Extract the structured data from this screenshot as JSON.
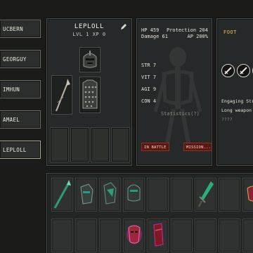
{
  "roster": [
    {
      "name": "UCBERN"
    },
    {
      "name": "GEORGUY"
    },
    {
      "name": "IMHUN"
    },
    {
      "name": "AMAEL"
    },
    {
      "name": "LEPLOLL"
    }
  ],
  "character": {
    "name": "LEPLOLL",
    "subtitle": "LVL 1   XP 0"
  },
  "stats": {
    "hp": "HP 459",
    "protection": "Protection 204",
    "damage": "Damage 61",
    "ap": "AP 200%",
    "str": "STR 7",
    "vit": "VIT 7",
    "agi": "AGI 9",
    "con": "CON 4",
    "statistics_link": "Statistics(?)",
    "in_battle": "IN BATTLE",
    "mission": "MISSION..."
  },
  "skill_panel": {
    "header": "FOOT",
    "skill_name": "Engaging Strik",
    "line2": "Long weapon",
    "line3": "????"
  },
  "colors": {
    "accent_gold": "#e6c34e",
    "battle_red": "#5b1712",
    "teal_weapon": "#2f9a78",
    "magenta_item": "#d0269a"
  },
  "icons": {
    "edit": "pencil-icon",
    "helmet": "helmet-icon",
    "weapon": "spear-icon",
    "armor": "chainmail-icon"
  }
}
